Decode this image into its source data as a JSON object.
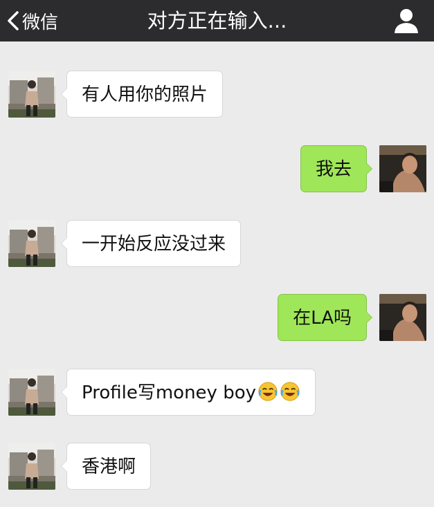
{
  "nav": {
    "back_label": "微信",
    "title": "对方正在输入..."
  },
  "messages": [
    {
      "side": "left",
      "text": ""
    },
    {
      "side": "left",
      "text": "有人用你的照片"
    },
    {
      "side": "right",
      "text": "我去"
    },
    {
      "side": "left",
      "text": "一开始反应没过来"
    },
    {
      "side": "right",
      "text": "在LA吗"
    },
    {
      "side": "left",
      "text": "Profile写money boy",
      "emoji": [
        "face-with-tears-of-joy",
        "face-with-tears-of-joy"
      ]
    },
    {
      "side": "left",
      "text": "香港啊"
    }
  ],
  "colors": {
    "navbar": "#2c2c2f",
    "background": "#ebebeb",
    "incoming_bubble": "#ffffff",
    "outgoing_bubble": "#9fe658"
  }
}
